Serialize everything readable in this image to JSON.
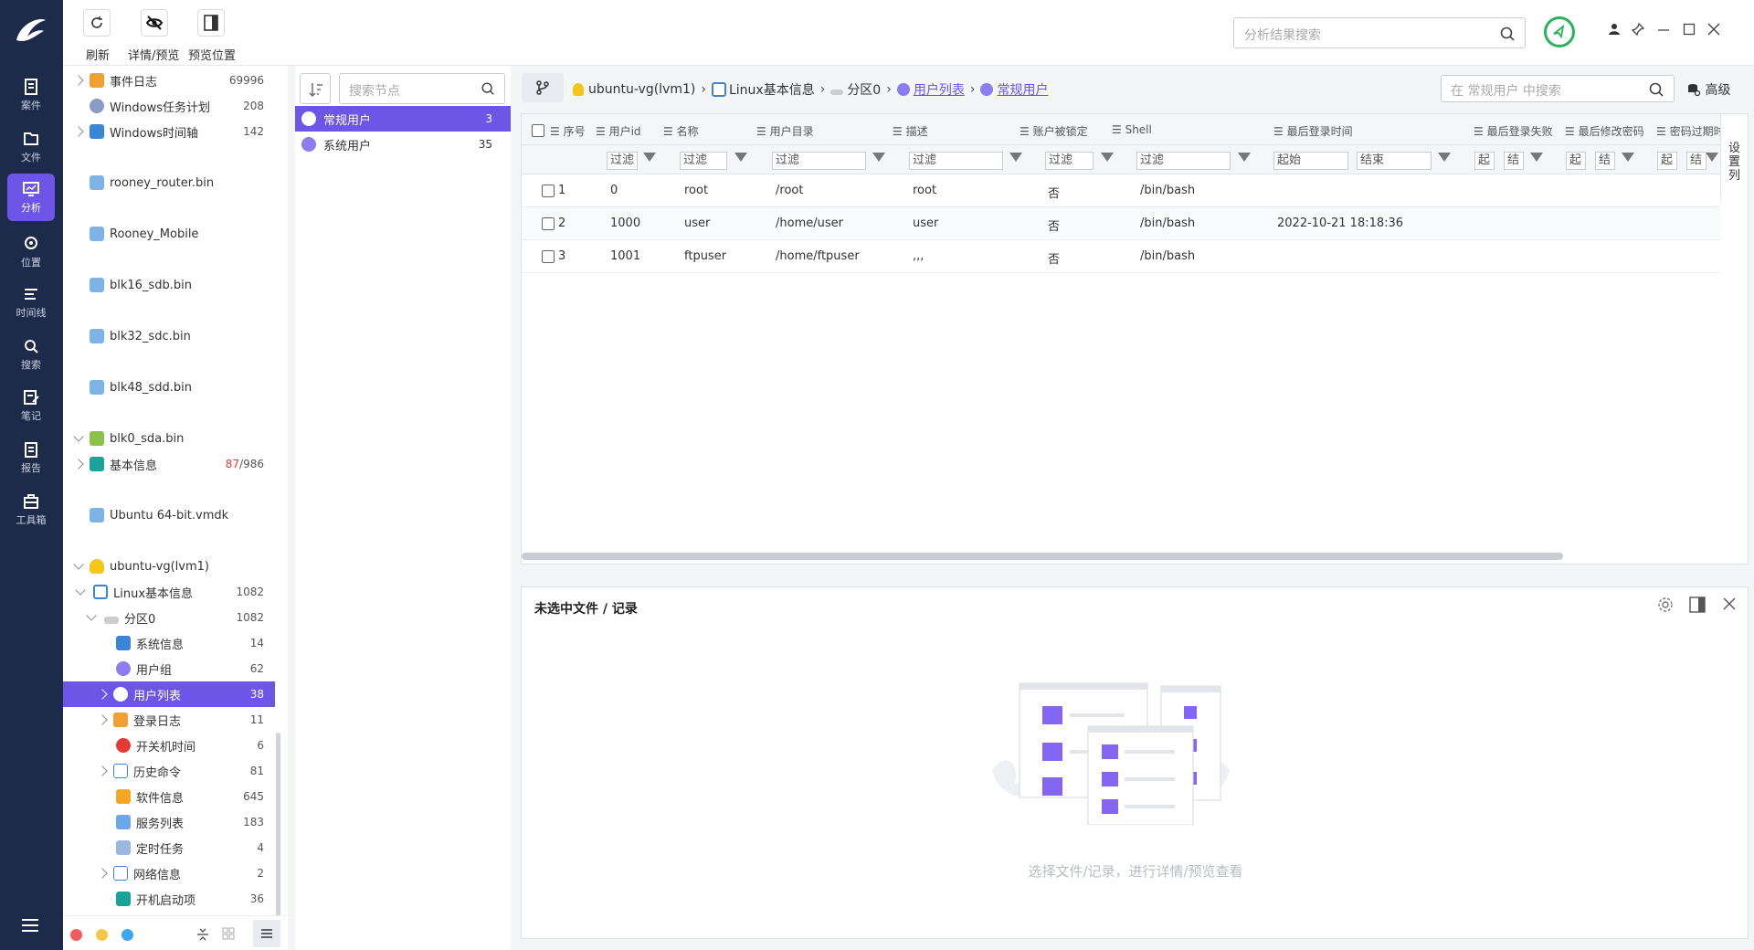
{
  "nav": {
    "items": [
      {
        "label": "案件",
        "icon": "case-icon"
      },
      {
        "label": "文件",
        "icon": "folder-icon"
      },
      {
        "label": "分析",
        "icon": "analysis-icon",
        "active": true
      },
      {
        "label": "位置",
        "icon": "location-icon"
      },
      {
        "label": "时间线",
        "icon": "timeline-icon"
      },
      {
        "label": "搜索",
        "icon": "search-icon"
      },
      {
        "label": "笔记",
        "icon": "note-icon"
      },
      {
        "label": "报告",
        "icon": "report-icon"
      },
      {
        "label": "工具箱",
        "icon": "toolbox-icon"
      }
    ],
    "accent": "#6d55e8",
    "background": "#1e2a4a"
  },
  "toolbar": {
    "refresh_label": "刷新",
    "detail_preview_label": "详情/预览",
    "preview_position_label": "预览位置",
    "search_placeholder": "分析结果搜索"
  },
  "tree": {
    "rows": [
      {
        "label": "事件日志",
        "count": "69996"
      },
      {
        "label": "Windows任务计划",
        "count": "208"
      },
      {
        "label": "Windows时间轴",
        "count": "142"
      },
      {
        "label": "rooney_router.bin",
        "count": ""
      },
      {
        "label": "Rooney_Mobile",
        "count": ""
      },
      {
        "label": "blk16_sdb.bin",
        "count": ""
      },
      {
        "label": "blk32_sdc.bin",
        "count": ""
      },
      {
        "label": "blk48_sdd.bin",
        "count": ""
      },
      {
        "label": "blk0_sda.bin",
        "count": ""
      },
      {
        "label": "基本信息",
        "count_red": "87",
        "count": "/986"
      },
      {
        "label": "Ubuntu 64-bit.vmdk",
        "count": ""
      },
      {
        "label": "ubuntu-vg(lvm1)",
        "count": ""
      },
      {
        "label": "Linux基本信息",
        "count": "1082"
      },
      {
        "label": "分区0",
        "count": "1082"
      },
      {
        "label": "系统信息",
        "count": "14"
      },
      {
        "label": "用户组",
        "count": "62"
      },
      {
        "label": "用户列表",
        "count": "38"
      },
      {
        "label": "登录日志",
        "count": "11"
      },
      {
        "label": "开关机时间",
        "count": "6"
      },
      {
        "label": "历史命令",
        "count": "81"
      },
      {
        "label": "软件信息",
        "count": "645"
      },
      {
        "label": "服务列表",
        "count": "183"
      },
      {
        "label": "定时任务",
        "count": "4"
      },
      {
        "label": "网络信息",
        "count": "2"
      },
      {
        "label": "开机启动项",
        "count": "36"
      }
    ]
  },
  "categories": {
    "search_placeholder": "搜索节点",
    "items": [
      {
        "label": "常规用户",
        "count": "3"
      },
      {
        "label": "系统用户",
        "count": "35"
      }
    ]
  },
  "breadcrumb": {
    "items": [
      "ubuntu-vg(lvm1)",
      "Linux基本信息",
      "分区0",
      "用户列表",
      "常规用户"
    ],
    "search_placeholder": "在 常规用户 中搜索",
    "advanced_label": "高级"
  },
  "grid": {
    "columns": [
      "序号",
      "用户id",
      "名称",
      "用户目录",
      "描述",
      "账户被锁定",
      "Shell",
      "最后登录时间",
      "最后登录失败",
      "最后修改密码",
      "密码过期时间"
    ],
    "filter_placeholder": "过滤",
    "range_start": "起始",
    "range_end": "结束",
    "range_start_short": "起",
    "range_end_short": "结",
    "settings_label": "设置列",
    "rows": [
      {
        "index": "1",
        "uid": "0",
        "name": "root",
        "home": "/root",
        "desc": "root",
        "locked": "否",
        "shell": "/bin/bash",
        "last_login": ""
      },
      {
        "index": "2",
        "uid": "1000",
        "name": "user",
        "home": "/home/user",
        "desc": "user",
        "locked": "否",
        "shell": "/bin/bash",
        "last_login": "2022-10-21 18:18:36"
      },
      {
        "index": "3",
        "uid": "1001",
        "name": "ftpuser",
        "home": "/home/ftpuser",
        "desc": ",,,",
        "locked": "否",
        "shell": "/bin/bash",
        "last_login": ""
      }
    ]
  },
  "detail": {
    "title": "未选中文件 / 记录",
    "empty_text": "选择文件/记录，进行详情/预览查看"
  }
}
